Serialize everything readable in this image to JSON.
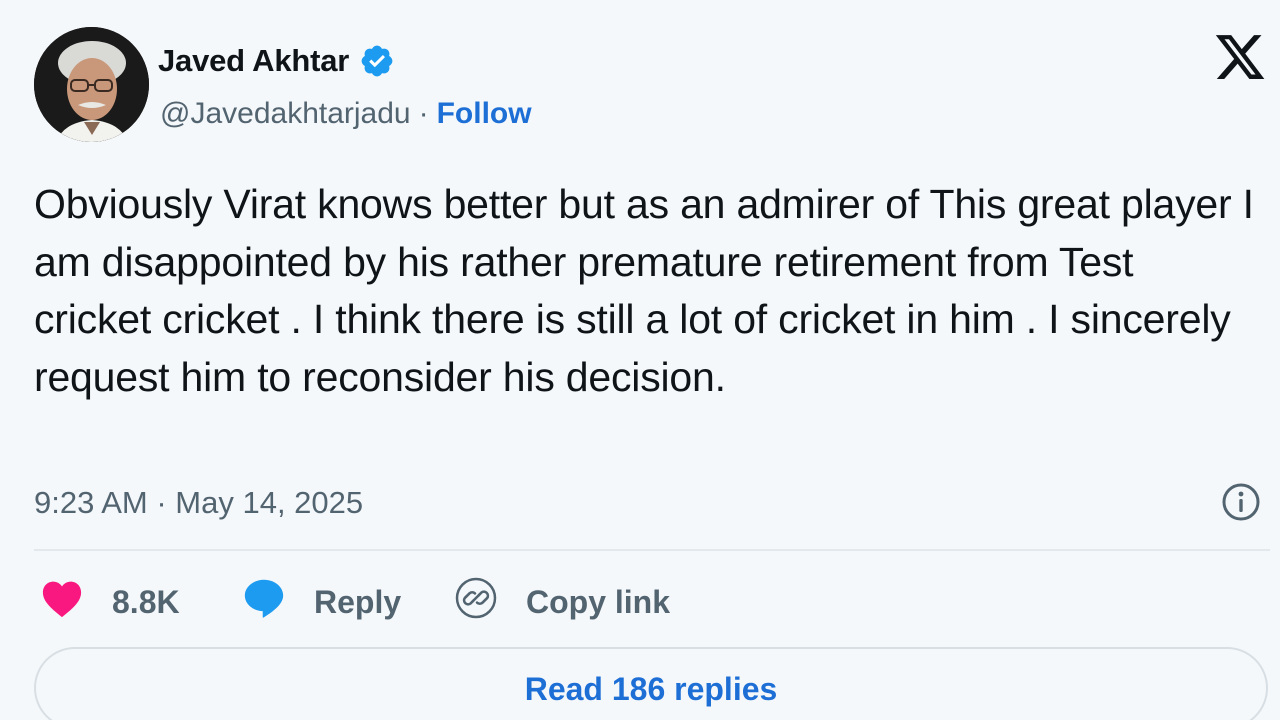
{
  "author": {
    "display_name": "Javed Akhtar",
    "handle": "@Javedakhtarjadu",
    "separator": "·",
    "follow_label": "Follow",
    "verified": true
  },
  "platform": {
    "logo_icon": "x-logo-icon"
  },
  "tweet": {
    "text": "Obviously Virat knows better but as an admirer of This great player I am disappointed by his rather premature retirement from Test cricket cricket . I think there is still a lot of cricket in him . I sincerely request him to reconsider his decision.",
    "timestamp": "9:23 AM · May 14, 2025"
  },
  "actions": {
    "like": {
      "icon": "heart-icon",
      "count": "8.8K"
    },
    "reply": {
      "icon": "speech-bubble-icon",
      "label": "Reply"
    },
    "copy_link": {
      "icon": "link-icon",
      "label": "Copy link"
    }
  },
  "footer": {
    "read_replies_label": "Read 186 replies"
  },
  "colors": {
    "background": "#f5f8fa",
    "text_primary": "#0f1419",
    "text_secondary": "#536471",
    "accent_blue": "#1d6fd6",
    "verified_blue": "#1d9bf0",
    "like_pink": "#f91880",
    "reply_blue": "#1d9bf0"
  }
}
